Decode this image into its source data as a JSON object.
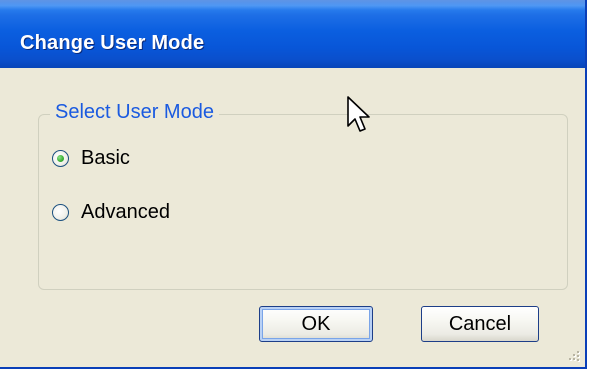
{
  "window": {
    "title": "Change User Mode"
  },
  "group": {
    "legend": "Select User Mode",
    "options": [
      {
        "label": "Basic",
        "selected": true
      },
      {
        "label": "Advanced",
        "selected": false
      }
    ]
  },
  "buttons": {
    "ok_label": "OK",
    "cancel_label": "Cancel"
  },
  "colors": {
    "titlebar_blue": "#0856d8",
    "dialog_face": "#ece9d8",
    "legend_text": "#1a5ae0",
    "radio_selected": "#3fb43a"
  },
  "icons": {
    "cursor": "mouse-pointer-icon",
    "resize_grip": "resize-grip-icon"
  }
}
